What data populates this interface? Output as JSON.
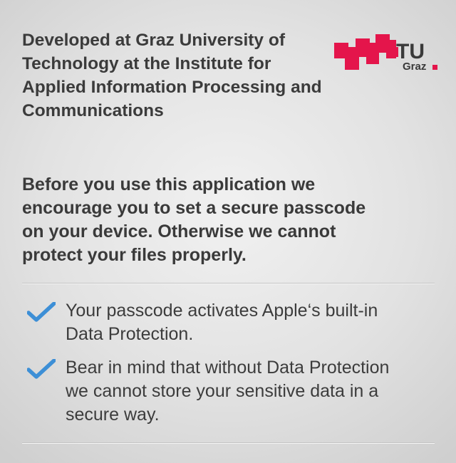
{
  "header": {
    "text": "Developed at Graz University of\nTechnology at the Institute for\nApplied Information Processing and\nCommunications"
  },
  "logo": {
    "name": "tu-graz-logo",
    "wordmark": "TU",
    "subtitle": "Graz",
    "brand_color": "#e4154b"
  },
  "notice": {
    "text": "Before you use this application we\nencourage you to set a secure passcode\non your device. Otherwise we cannot\nprotect your files properly."
  },
  "points": [
    {
      "icon": "checkmark-icon",
      "text": "Your passcode activates Apple‘s built-in\nData Protection."
    },
    {
      "icon": "checkmark-icon",
      "text": "Bear in mind that without Data Protection\nwe cannot store your sensitive data in a\nsecure way."
    }
  ],
  "colors": {
    "check": "#3d8fd6",
    "text": "#3a3a3a"
  }
}
